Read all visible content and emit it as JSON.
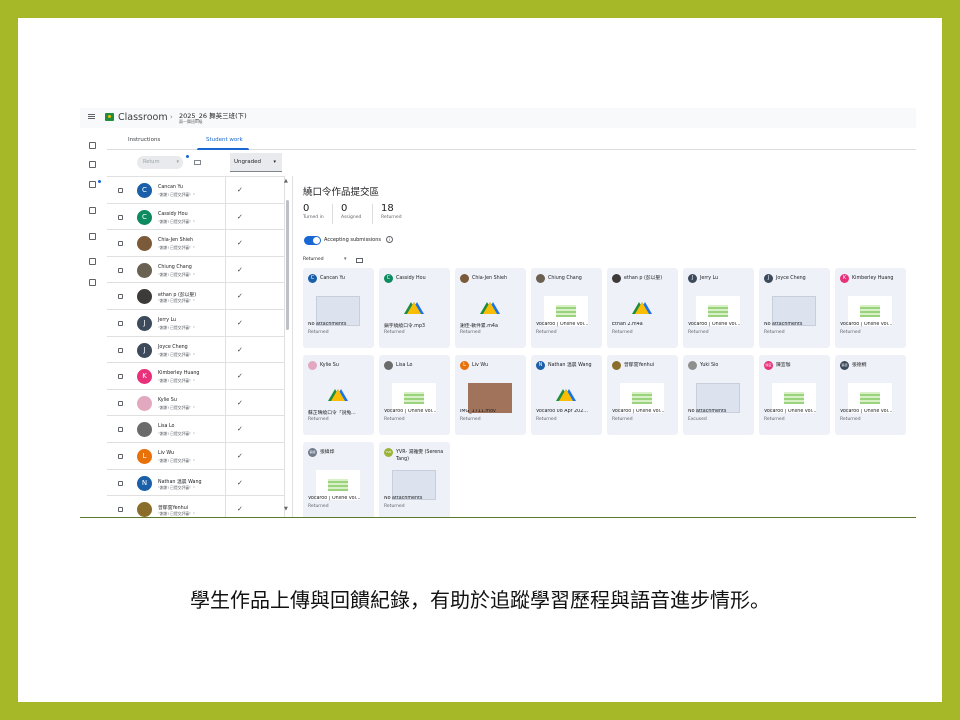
{
  "caption": "學生作品上傳與回饋紀錄，有助於追蹤學習歷程與語音進步情形。",
  "app": {
    "name": "Classroom",
    "course_title": "2025_26 舞英三班(下)",
    "course_sub": "兩一舞班III級"
  },
  "tabs": [
    {
      "label": "Instructions"
    },
    {
      "label": "Student work"
    }
  ],
  "toolbar": {
    "return_label": "Return",
    "filter_value": "Ungraded"
  },
  "students": [
    {
      "name": "Cancan Yu",
      "note": "\"謝謝! 已提交評審！\"",
      "initial": "C",
      "color": "#1a5fa8",
      "checked": "✓"
    },
    {
      "name": "Cassidy Hou",
      "note": "\"謝謝! 已提交評審！\"",
      "initial": "C",
      "color": "#0d8a5f",
      "checked": "✓"
    },
    {
      "name": "Chia-Jen Shieh",
      "note": "\"謝謝! 已提交評審！\"",
      "initial": "",
      "color": "#7b5a3a",
      "checked": "✓"
    },
    {
      "name": "Chiung Chang",
      "note": "\"謝謝! 已提交評審！\"",
      "initial": "",
      "color": "#6a6152",
      "checked": "✓"
    },
    {
      "name": "ethan p (彭以聖)",
      "note": "\"謝謝! 已提交評審！\"",
      "initial": "",
      "color": "#3f3a3a",
      "checked": "✓"
    },
    {
      "name": "Jerry Lu",
      "note": "\"謝謝! 已提交評審！\"",
      "initial": "J",
      "color": "#3c4a5c",
      "checked": "✓"
    },
    {
      "name": "Joyce Cheng",
      "note": "\"謝謝! 已提交評審！\"",
      "initial": "J",
      "color": "#3c4a5c",
      "checked": "✓"
    },
    {
      "name": "Kimberley Huang",
      "note": "\"謝謝! 已提交評審！\"",
      "initial": "K",
      "color": "#e8317a",
      "checked": "✓"
    },
    {
      "name": "Kylie Su",
      "note": "\"謝謝! 已提交評審！\"",
      "initial": "",
      "color": "#e2a8c0",
      "checked": "✓"
    },
    {
      "name": "Lisa Lo",
      "note": "\"謝謝! 已提交評審！\"",
      "initial": "",
      "color": "#6b6b6b",
      "checked": "✓"
    },
    {
      "name": "Liv Wu",
      "note": "\"謝謝! 已提交評審！\"",
      "initial": "L",
      "color": "#e8710a",
      "checked": "✓"
    },
    {
      "name": "Nathan 溫晨 Wang",
      "note": "\"謝謝! 已提交評審！\"",
      "initial": "N",
      "color": "#1a5fa8",
      "checked": "✓"
    },
    {
      "name": "曾郁雲Yenhui",
      "note": "\"謝謝! 已提交評審！\"",
      "initial": "",
      "color": "#8a6d2a",
      "checked": "✓"
    }
  ],
  "detail": {
    "title": "繞口令作品提交區",
    "stats": [
      {
        "n": "0",
        "l": "Turned in"
      },
      {
        "n": "0",
        "l": "Assigned"
      },
      {
        "n": "18",
        "l": "Returned"
      }
    ],
    "accepting_label": "Accepting submissions",
    "accepting": true,
    "filter_label": "Returned"
  },
  "cards": [
    {
      "name": "Cancan Yu",
      "initial": "C",
      "color": "#1a5fa8",
      "thumb": "blank",
      "file": "No attachments",
      "status": "Returned"
    },
    {
      "name": "Cassidy Hou",
      "initial": "C",
      "color": "#0d8a5f",
      "thumb": "drive",
      "file": "鍋字繞繞口令.mp3",
      "status": "Returned"
    },
    {
      "name": "Chia-Jen Shieh",
      "initial": "",
      "color": "#7b5a3a",
      "thumb": "drive",
      "file": "謝佳-軟件累.m4a",
      "status": "Returned"
    },
    {
      "name": "Chiung Chang",
      "initial": "",
      "color": "#6a6152",
      "thumb": "voc",
      "file": "Vocaroo | Online voi...",
      "status": "Returned"
    },
    {
      "name": "ethan p (彭以聖)",
      "initial": "",
      "color": "#3f3a3a",
      "thumb": "drive",
      "file": "Ethan 2.m4a",
      "status": "Returned"
    },
    {
      "name": "Jerry Lu",
      "initial": "J",
      "color": "#3c4a5c",
      "thumb": "voc",
      "file": "Vocaroo | Online voi...",
      "status": "Returned"
    },
    {
      "name": "Joyce Cheng",
      "initial": "J",
      "color": "#3c4a5c",
      "thumb": "blank",
      "file": "No attachments",
      "status": "Returned"
    },
    {
      "name": "Kimberley Huang",
      "initial": "K",
      "color": "#e8317a",
      "thumb": "voc",
      "file": "Vocaroo | Online voi...",
      "status": "Returned"
    },
    {
      "name": "Kylie Su",
      "initial": "",
      "color": "#e2a8c0",
      "thumb": "drive",
      "file": "蘇芷晴繞口令「說兔...",
      "status": "Returned"
    },
    {
      "name": "Lisa Lo",
      "initial": "",
      "color": "#6b6b6b",
      "thumb": "voc",
      "file": "Vocaroo | Online voi...",
      "status": "Returned"
    },
    {
      "name": "Liv Wu",
      "initial": "L",
      "color": "#e8710a",
      "thumb": "photo",
      "file": "IMG_1711.mov",
      "status": "Returned"
    },
    {
      "name": "Nathan 溫晨 Wang",
      "initial": "N",
      "color": "#1a5fa8",
      "thumb": "drive",
      "file": "Vocaroo 08 Apr 202...",
      "status": "Returned"
    },
    {
      "name": "曾郁雲Yenhui",
      "initial": "",
      "color": "#8a6d2a",
      "thumb": "voc",
      "file": "Vocaroo | Online voi...",
      "status": "Returned"
    },
    {
      "name": "Yuki Sio",
      "initial": "",
      "color": "#8f8f8f",
      "thumb": "blank",
      "file": "No attachments",
      "status": "Excused"
    },
    {
      "name": "陳宜珈",
      "initial": "陳宜",
      "color": "#e8317a",
      "thumb": "voc",
      "file": "Vocaroo | Online voi...",
      "status": "Returned"
    },
    {
      "name": "張德桐",
      "initial": "張德",
      "color": "#3c4a5c",
      "thumb": "voc",
      "file": "Vocaroo | Online voi...",
      "status": "Returned"
    },
    {
      "name": "張緯烨",
      "initial": "張緯",
      "color": "#6f7a8a",
      "thumb": "voc",
      "file": "Vocaroo | Online voi...",
      "status": "Returned"
    },
    {
      "name": "YVR- 湯雅雯 (Serena Tang)",
      "initial": "YVR",
      "color": "#9cb33a",
      "thumb": "blank",
      "file": "No attachments",
      "status": "Returned"
    }
  ]
}
